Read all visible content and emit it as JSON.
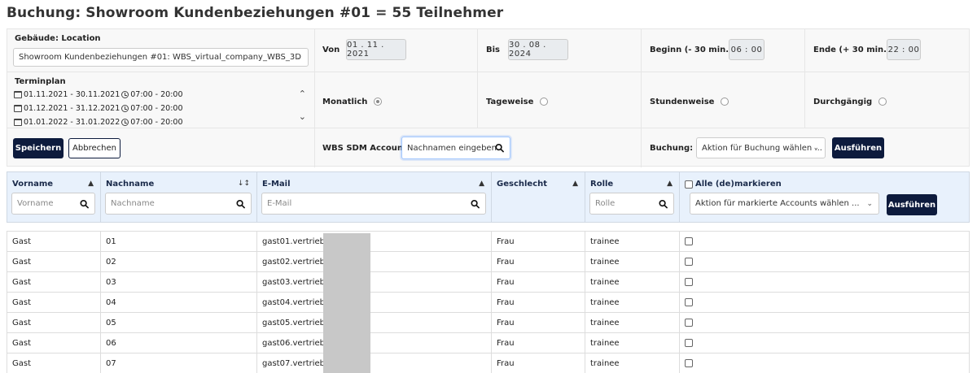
{
  "page": {
    "title": "Buchung: Showroom Kundenbeziehungen #01 = 55 Teilnehmer"
  },
  "form": {
    "location_label": "Gebäude: Location",
    "location_value": "Showroom Kundenbeziehungen #01: WBS_virtual_company_WBS_3D",
    "von_label": "Von",
    "von_value": "01 . 11 . 2021",
    "bis_label": "Bis",
    "bis_value": "30 . 08 . 2024",
    "beginn_label": "Beginn (- 30 min.)",
    "beginn_value": "06 : 00",
    "ende_label": "Ende (+ 30 min.)",
    "ende_value": "22 : 00",
    "terminplan_label": "Terminplan",
    "terminplan": [
      {
        "dates": "01.11.2021 - 30.11.2021",
        "time": "07:00 - 20:00"
      },
      {
        "dates": "01.12.2021 - 31.12.2021",
        "time": "07:00 - 20:00"
      },
      {
        "dates": "01.01.2022 - 31.01.2022",
        "time": "07:00 - 20:00"
      }
    ],
    "radios": {
      "monatlich": "Monatlich",
      "tageweise": "Tageweise",
      "stundenweise": "Stundenweise",
      "durchgaengig": "Durchgängig"
    },
    "save_label": "Speichern",
    "cancel_label": "Abbrechen",
    "account_label": "WBS SDM Account",
    "account_value": "Nachnamen eingeben",
    "buchung_label": "Buchung:",
    "buchung_select": "Aktion für Buchung wählen ...",
    "buchung_execute": "Ausführen"
  },
  "table": {
    "headers": {
      "vorname": "Vorname",
      "nachname": "Nachname",
      "email": "E-Mail",
      "geschlecht": "Geschlecht",
      "rolle": "Rolle",
      "select_all": "Alle (de)markieren"
    },
    "filters": {
      "vorname": "Vorname",
      "nachname": "Nachname",
      "email": "E-Mail",
      "rolle": "Rolle",
      "action": "Aktion für markierte Accounts wählen ...",
      "execute": "Ausführen"
    },
    "rows": [
      {
        "vorname": "Gast",
        "nachname": "01",
        "email": "gast01.vertrieb@",
        "geschlecht": "Frau",
        "rolle": "trainee"
      },
      {
        "vorname": "Gast",
        "nachname": "02",
        "email": "gast02.vertrieb@",
        "geschlecht": "Frau",
        "rolle": "trainee"
      },
      {
        "vorname": "Gast",
        "nachname": "03",
        "email": "gast03.vertrieb@",
        "geschlecht": "Frau",
        "rolle": "trainee"
      },
      {
        "vorname": "Gast",
        "nachname": "04",
        "email": "gast04.vertrieb@",
        "geschlecht": "Frau",
        "rolle": "trainee"
      },
      {
        "vorname": "Gast",
        "nachname": "05",
        "email": "gast05.vertrieb@",
        "geschlecht": "Frau",
        "rolle": "trainee"
      },
      {
        "vorname": "Gast",
        "nachname": "06",
        "email": "gast06.vertrieb@",
        "geschlecht": "Frau",
        "rolle": "trainee"
      },
      {
        "vorname": "Gast",
        "nachname": "07",
        "email": "gast07.vertrieb@",
        "geschlecht": "Frau",
        "rolle": "trainee"
      }
    ]
  },
  "icons": {
    "search": "search-icon",
    "chevron": "chevron-down-icon",
    "calendar": "calendar-icon",
    "clock": "clock-icon",
    "sort": "sort-icon"
  },
  "colors": {
    "primary": "#0d1b3d",
    "header_bg": "#e8f1fc",
    "panel_bg": "#f8f8f8"
  }
}
